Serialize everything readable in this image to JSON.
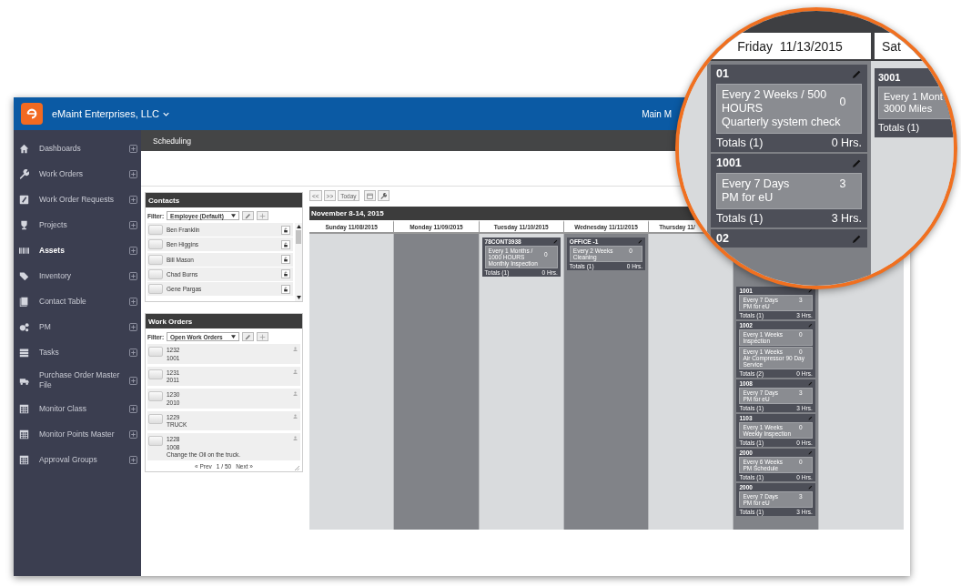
{
  "header": {
    "company": "eMaint Enterprises, LLC",
    "menu_label": "Main M"
  },
  "sidebar": {
    "items": [
      {
        "label": "Dashboards",
        "selected": false
      },
      {
        "label": "Work Orders",
        "selected": false
      },
      {
        "label": "Work Order Requests",
        "selected": false
      },
      {
        "label": "Projects",
        "selected": false
      },
      {
        "label": "Assets",
        "selected": true
      },
      {
        "label": "Inventory",
        "selected": false
      },
      {
        "label": "Contact Table",
        "selected": false
      },
      {
        "label": "PM",
        "selected": false
      },
      {
        "label": "Tasks",
        "selected": false
      },
      {
        "label": "Purchase Order Master File",
        "selected": false
      },
      {
        "label": "Monitor Class",
        "selected": false
      },
      {
        "label": "Monitor Points Master",
        "selected": false
      },
      {
        "label": "Approval Groups",
        "selected": false
      }
    ]
  },
  "breadcrumb": "Scheduling",
  "contacts": {
    "title": "Contacts",
    "filter_label": "Filter:",
    "filter_value": "Employee (Default)",
    "rows": [
      "Ben Franklin",
      "Ben Higgins",
      "Bill Mason",
      "Chad Burns",
      "Gene Pargas"
    ]
  },
  "work_orders": {
    "title": "Work Orders",
    "filter_label": "Filter:",
    "filter_value": "Open Work Orders",
    "rows": [
      {
        "lines": [
          "1232",
          "1001"
        ]
      },
      {
        "lines": [
          "1231",
          "2011"
        ]
      },
      {
        "lines": [
          "1230",
          "2010"
        ]
      },
      {
        "lines": [
          "1229",
          "TRUCK"
        ]
      },
      {
        "lines": [
          "1228",
          "1008",
          "Change the Oil on the truck."
        ]
      }
    ],
    "pager": {
      "prev": "« Prev",
      "page": "1 / 50",
      "next": "Next »"
    }
  },
  "calendar": {
    "toolbar": [
      "<<",
      ">>",
      "Today"
    ],
    "week_title": "November 8-14, 2015",
    "days": [
      {
        "label": "Sunday 11/08/2015"
      },
      {
        "label": "Monday 11/09/2015"
      },
      {
        "label": "Tuesday 11/10/2015",
        "cards": [
          {
            "title": "78CONT3938",
            "items": [
              {
                "schedule": "Every 1 Months / 1000 HOURS",
                "task": "Monthly Inspection",
                "count": "0"
              }
            ],
            "totals": "Totals (1)",
            "hours": "0 Hrs."
          }
        ]
      },
      {
        "label": "Wednesday 11/11/2015",
        "cards": [
          {
            "title": "OFFICE -1",
            "items": [
              {
                "schedule": "Every 2 Weeks",
                "task": "Cleaning",
                "count": "0"
              }
            ],
            "totals": "Totals (1)",
            "hours": "0 Hrs."
          }
        ]
      },
      {
        "label": "Thursday 11/"
      },
      {
        "cards": [
          {
            "title": "1001",
            "items": [
              {
                "schedule": "Every 7 Days",
                "task": "PM for eU",
                "count": "3"
              }
            ],
            "totals": "Totals (1)",
            "hours": "3 Hrs."
          },
          {
            "title": "1002",
            "items": [
              {
                "schedule": "Every 1 Weeks",
                "task": "Inspection",
                "count": "0"
              },
              {
                "schedule": "Every 1 Weeks",
                "task": "Air Compressor 90 Day Service",
                "count": "0"
              }
            ],
            "totals": "Totals (2)",
            "hours": "0 Hrs."
          },
          {
            "title": "1008",
            "items": [
              {
                "schedule": "Every 7 Days",
                "task": "PM for eU",
                "count": "3"
              }
            ],
            "totals": "Totals (1)",
            "hours": "3 Hrs."
          },
          {
            "title": "1103",
            "items": [
              {
                "schedule": "Every 1 Weeks",
                "task": "Weekly Inspection",
                "count": "0"
              }
            ],
            "totals": "Totals (1)",
            "hours": "0 Hrs."
          },
          {
            "title": "2000",
            "items": [
              {
                "schedule": "Every 6 Weeks",
                "task": "PM Schedule",
                "count": "0"
              }
            ],
            "totals": "Totals (1)",
            "hours": "0 Hrs."
          },
          {
            "title": "2000",
            "items": [
              {
                "schedule": "Every 7 Days",
                "task": "PM for eU",
                "count": "3"
              }
            ],
            "totals": "Totals (1)",
            "hours": "3 Hrs."
          }
        ]
      }
    ]
  },
  "magnifier": {
    "columns": [
      {
        "label": "Friday  11/13/2015",
        "cards": [
          {
            "title": "01",
            "items": [
              {
                "schedule": "Every 2 Weeks / 500 HOURS",
                "task": "Quarterly system check",
                "count": "0"
              }
            ],
            "totals": "Totals (1)",
            "hours": "0 Hrs."
          },
          {
            "title": "1001",
            "items": [
              {
                "schedule": "Every 7 Days",
                "task": "PM for eU",
                "count": "3"
              }
            ],
            "totals": "Totals (1)",
            "hours": "3 Hrs."
          },
          {
            "title": "02"
          }
        ]
      },
      {
        "label": "Sat",
        "cards": [
          {
            "title": "3001",
            "items": [
              {
                "schedule": "Every 1 Mont",
                "task": "3000 Miles"
              }
            ],
            "totals": "Totals (1)"
          }
        ]
      }
    ]
  }
}
